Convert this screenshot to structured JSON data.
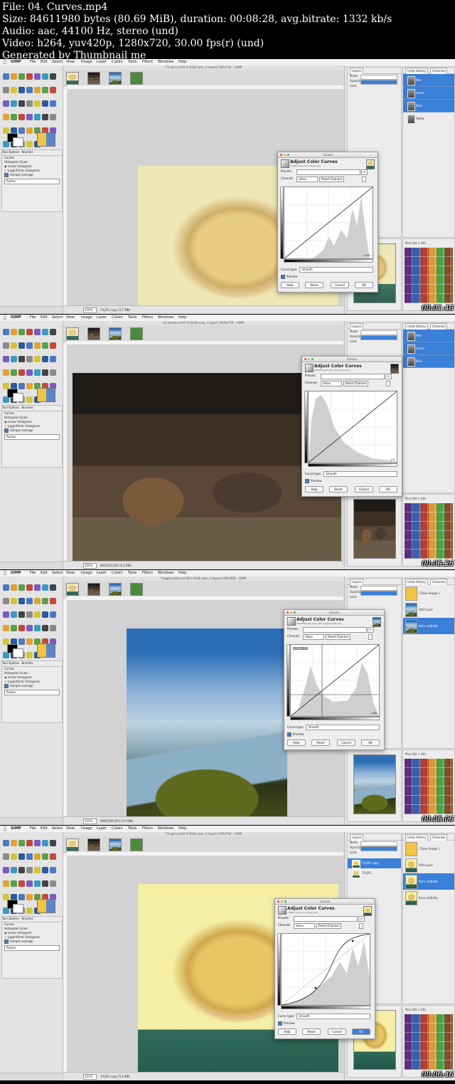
{
  "header": {
    "file": "File: 04. Curves.mp4",
    "size": "Size: 84611980 bytes (80.69 MiB), duration: 00:08:28, avg.bitrate: 1332 kb/s",
    "audio": "Audio: aac, 44100 Hz, stereo (und)",
    "video": "Video: h264, yuv420p, 1280x720, 30.00 fps(r) (und)",
    "generated": "Generated by Thumbnail me"
  },
  "menu": [
    "GIMP",
    "File",
    "Edit",
    "Select",
    "View",
    "Image",
    "Layer",
    "Colors",
    "Tools",
    "Filters",
    "Windows",
    "Help"
  ],
  "tool_options": {
    "tabs": [
      "Tool Options",
      "Brushes"
    ],
    "title": "Curves",
    "histogram_scale": "Histogram Scale",
    "linear": "Linear histogram",
    "logarithmic": "Logarithmic histogram",
    "sample_average": "Sample average",
    "radius": "Radius"
  },
  "layers_panel": {
    "tab": "Layers",
    "mode_label": "Mode",
    "mode_value": "Normal",
    "opacity_label": "Opacity",
    "lock_label": "Lock:"
  },
  "undo_panel": {
    "tab_undo": "Undo History",
    "tab_channels": "Channels"
  },
  "channels": [
    "Red",
    "Green",
    "Blue",
    "Alpha"
  ],
  "undo_items": [
    "[ Base Image ]",
    "Add Layer",
    "Item visibility",
    "Item visibility"
  ],
  "layer_items": [
    "74.JPG copy",
    "74.JPG"
  ],
  "patterns_label": "Pine (64 × 64)",
  "dialog": {
    "window_title": "Curves",
    "title": "Adjust Color Curves",
    "presets": "Presets:",
    "channel": "Channel:",
    "channel_value": "Value",
    "reset_channel": "Reset Channel",
    "curve_type": "Curve type:",
    "curve_value": "Smooth",
    "preview": "Preview",
    "help": "Help",
    "reset": "Reset",
    "cancel": "Cancel",
    "ok": "OK"
  },
  "frames": [
    {
      "timestamp": "00:01:46",
      "title": "*74-girl.xcf-46.0 (RGB color, 2 layers) 595x724 – GIMP",
      "sub": "74.JPG copy-173 (74-girl.xcf)",
      "status": "74.JPG copy (4.7 MB)",
      "readout": "x:244"
    },
    {
      "timestamp": "00:03:26",
      "title": "14-horses.xcf-47.0 (RGB color, 1 layer) 1000x750 – GIMP",
      "sub": "IMG0101.JPG-187 (14-horses.xcf)",
      "status": "IMG0101.JPG (6.2 MB)",
      "readout": "x:9"
    },
    {
      "timestamp": "00:05:06",
      "title": "*niagara-falls.xcf-48.0 (RGB color, 2 layers) 600x800 – GIMP",
      "sub": "DMG1660.JPG copy-174 (niagara-falls.xcf)",
      "status": "DMG1660.JPG (5.0 MB)",
      "readout": "x:88",
      "point_readout": "x: 88 y: 77"
    },
    {
      "timestamp": "00:06:46",
      "title": "*74-girl.xcf-46.0 (RGB color, 2 layers) 595x724 – GIMP",
      "sub": "74.JPG copy-173 (74-girl.xcf)",
      "status": "74.JPG copy (5.0 MB)",
      "readout": ""
    }
  ],
  "colors": {
    "accent": "#3a7fd8",
    "window": "#ededed"
  }
}
